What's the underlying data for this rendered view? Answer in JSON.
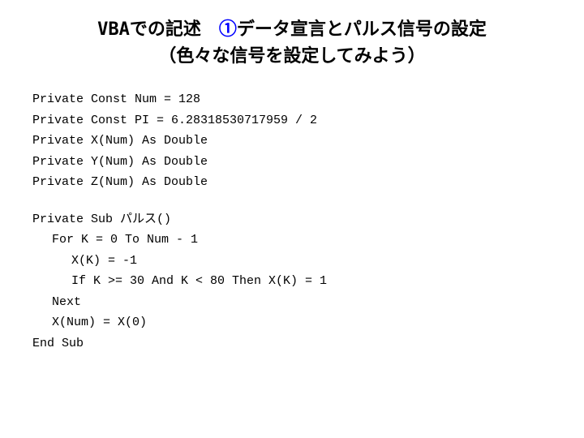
{
  "title": {
    "line1": "VBAでの記述　①データ宣言とパルス信号の設定",
    "line2": "（色々な信号を設定してみよう）"
  },
  "code": {
    "declarations": [
      "Private Const Num = 128",
      "Private Const PI = 6.28318530717959 / 2",
      "Private X(Num) As Double",
      "Private Y(Num) As Double",
      "Private Z(Num) As Double"
    ],
    "sub_block": {
      "sub_start": "Private Sub パルス()",
      "for_start": "For K = 0 To Num - 1",
      "line1": "X(K) = -1",
      "if_line": "If K >= 30 And K < 80 Then X(K) = 1",
      "next": "Next",
      "x_num": "X(Num) = X(0)",
      "end_sub": "End Sub"
    }
  }
}
